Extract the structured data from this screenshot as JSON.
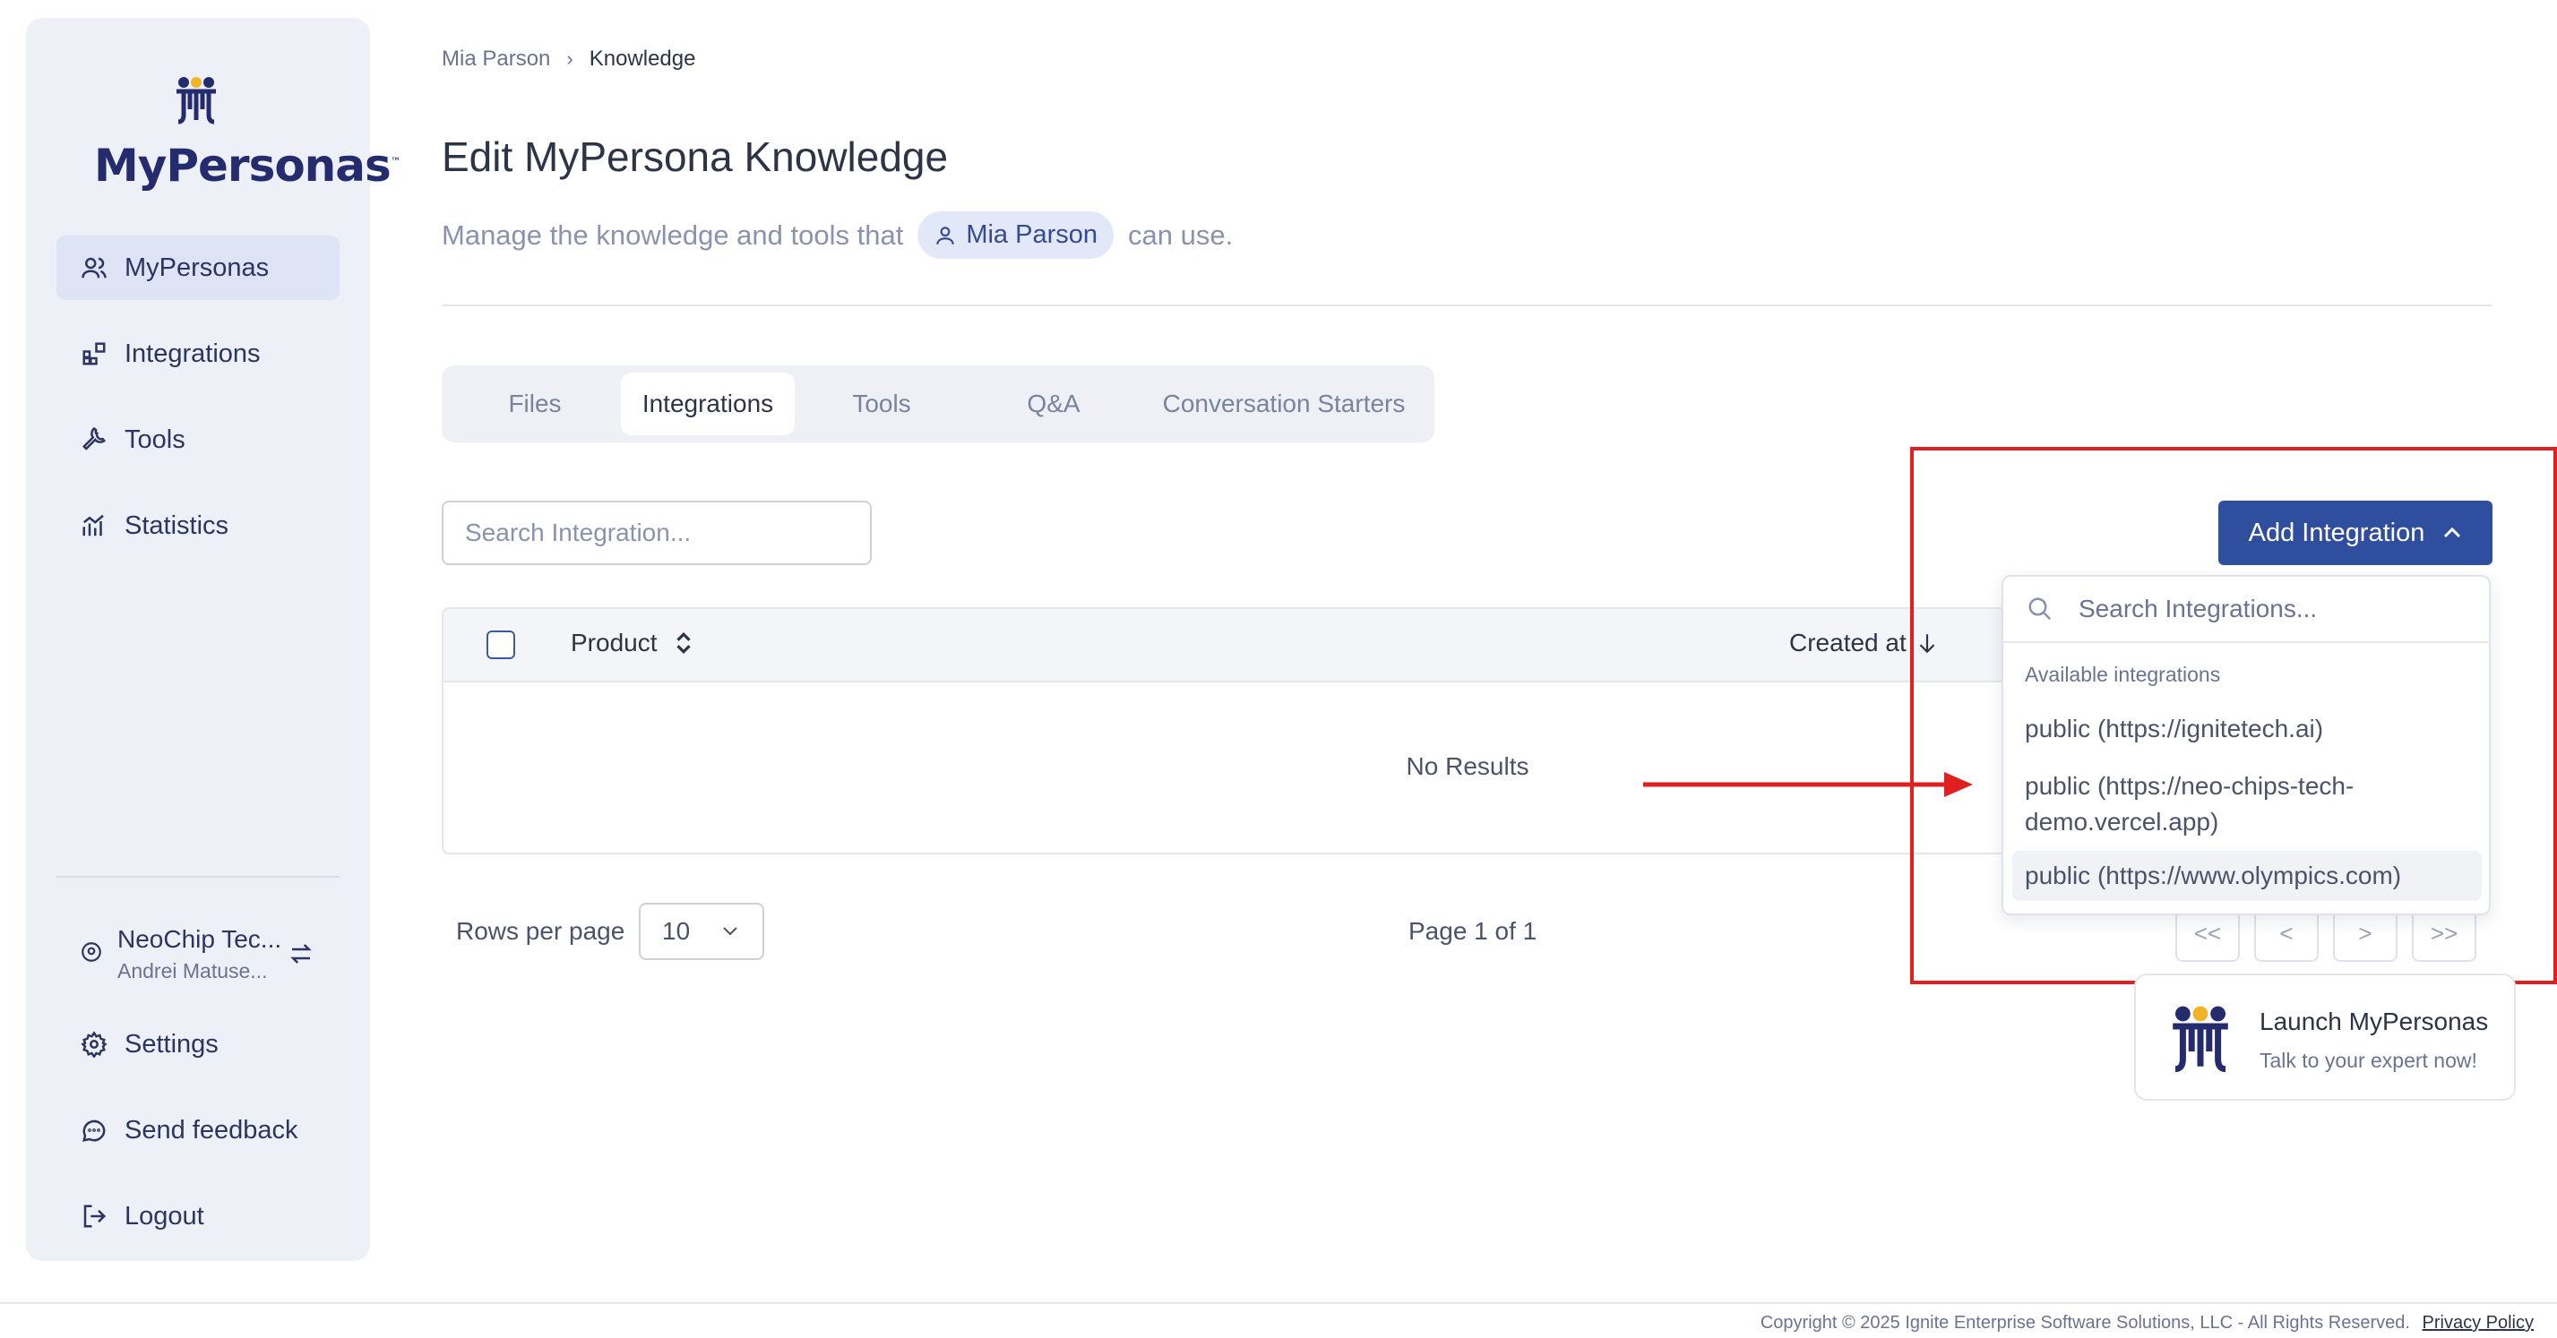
{
  "brand": {
    "name": "MyPersonas",
    "tm": "™",
    "accent": "#2f4f9e"
  },
  "sidebar": {
    "items": [
      {
        "label": "MyPersonas",
        "icon": "users-icon"
      },
      {
        "label": "Integrations",
        "icon": "integrations-icon"
      },
      {
        "label": "Tools",
        "icon": "wrench-icon"
      },
      {
        "label": "Statistics",
        "icon": "chart-icon"
      }
    ],
    "org": {
      "name": "NeoChip Tec...",
      "user": "Andrei Matuse..."
    },
    "bottom": [
      {
        "label": "Settings",
        "icon": "gear-icon"
      },
      {
        "label": "Send feedback",
        "icon": "feedback-icon"
      },
      {
        "label": "Logout",
        "icon": "logout-icon"
      }
    ]
  },
  "breadcrumb": {
    "parent": "Mia Parson",
    "current": "Knowledge"
  },
  "page": {
    "title": "Edit MyPersona Knowledge",
    "subtitle_before": "Manage the knowledge and tools that",
    "persona": "Mia Parson",
    "subtitle_after": "can use."
  },
  "tabs": [
    "Files",
    "Integrations",
    "Tools",
    "Q&A",
    "Conversation Starters"
  ],
  "active_tab": "Integrations",
  "search": {
    "placeholder": "Search Integration..."
  },
  "table": {
    "columns": {
      "product": "Product",
      "created": "Created at"
    },
    "empty": "No Results"
  },
  "pagination": {
    "rows_label": "Rows per page",
    "rows_value": "10",
    "page_info": "Page 1 of 1",
    "first": "<<",
    "prev": "<",
    "next": ">",
    "last": ">>"
  },
  "add_integration": {
    "label": "Add Integration",
    "search_placeholder": "Search Integrations...",
    "group": "Available integrations",
    "options": [
      "public (https://ignitetech.ai)",
      "public (https://neo-chips-tech-demo.vercel.app)",
      "public (https://www.olympics.com)"
    ]
  },
  "launch": {
    "title": "Launch MyPersonas",
    "subtitle": "Talk to your expert now!"
  },
  "footer": {
    "copyright": "Copyright © 2025 Ignite Enterprise Software Solutions, LLC - All Rights Reserved.",
    "privacy": "Privacy Policy"
  },
  "annotation_color": "#e02020"
}
